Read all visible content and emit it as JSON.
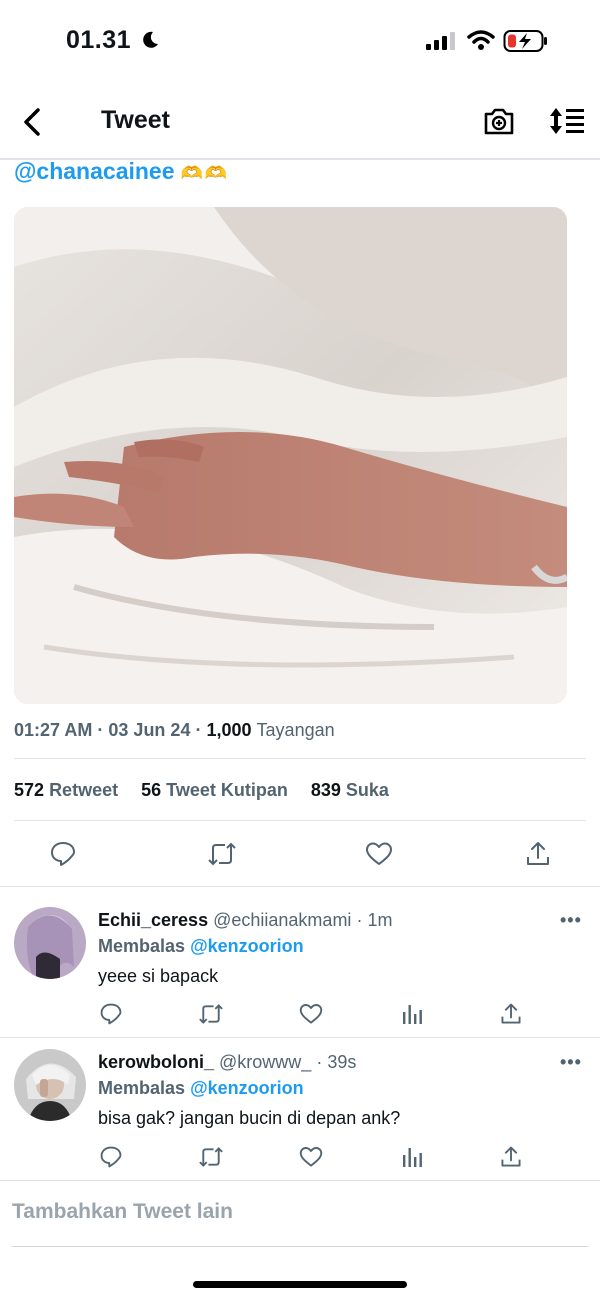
{
  "status_bar": {
    "time": "01.31",
    "icons": [
      "moon-icon",
      "signal-icon",
      "wifi-icon",
      "battery-charging-icon"
    ]
  },
  "nav": {
    "title": "Tweet",
    "icons": [
      "back-arrow-icon",
      "camera-add-icon",
      "sort-icon"
    ]
  },
  "tweet": {
    "mention": "@chanacainee",
    "mention_emoji": "🫶🫶",
    "time": "01:27 AM",
    "date": "03 Jun 24",
    "dot": "·",
    "views_count": "1,000",
    "views_label": "Tayangan",
    "retweets_count": "572",
    "retweets_label": "Retweet",
    "quotes_count": "56",
    "quotes_label": "Tweet Kutipan",
    "likes_count": "839",
    "likes_label": "Suka"
  },
  "replies": [
    {
      "name": "Echii_ceress",
      "handle": "@echiianakmami",
      "time": "1m",
      "replying_label": "Membalas",
      "replying_to": "@kenzoorion",
      "text": "yeee si bapack"
    },
    {
      "name": "kerowboloni_",
      "handle": "@krowww_",
      "time": "39s",
      "replying_label": "Membalas",
      "replying_to": "@kenzoorion",
      "text": "bisa gak? jangan bucin di depan ank?"
    }
  ],
  "more_label": "•••",
  "add_tweet_placeholder": "Tambahkan Tweet lain",
  "colors": {
    "accent": "#1d9bf0",
    "secondary_text": "#536471",
    "primary_text": "#0f1419"
  }
}
